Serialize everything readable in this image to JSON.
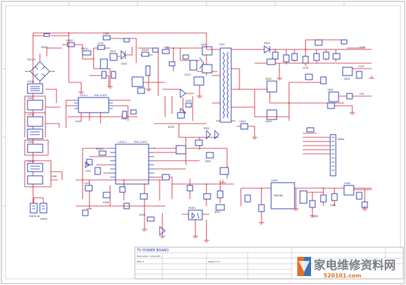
{
  "ic_labels": {
    "u1": "U1I4-1",
    "u1_part": "TDA 4745T",
    "u2": "U1I4-2",
    "u2_part": "TDA 4745T",
    "u3": "U005",
    "u4": "U004",
    "u5": "U003"
  },
  "bridge_label": "BD101",
  "transformer_label": "T901",
  "title_block": {
    "title": "TV POWER BOARD",
    "line2": "Description: Schematic",
    "line3": "REV: A",
    "line4": "Sheet 1 of 1"
  },
  "watermark": {
    "text_cn": "家电维修资料网",
    "url": "520101.com"
  },
  "colors": {
    "wire": "#c8142a",
    "component": "#1a2fa8",
    "watermark_gray": "#7a7f86",
    "watermark_orange": "#e0702a"
  }
}
